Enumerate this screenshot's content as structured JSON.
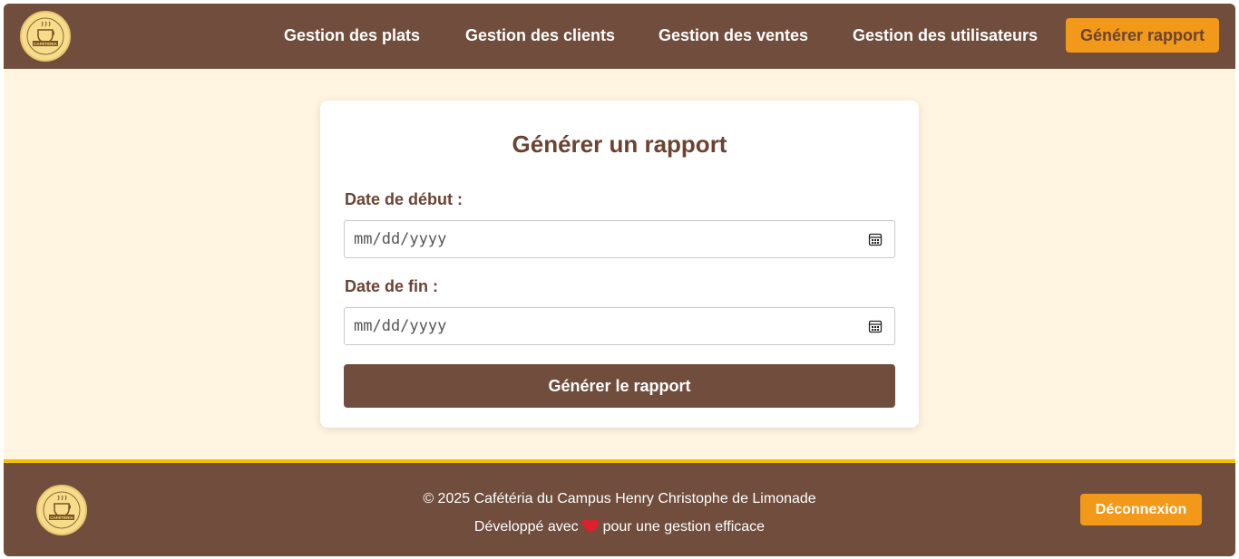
{
  "header": {
    "logo_text": "CAFÉTÉRIA",
    "nav": [
      {
        "label": "Gestion des plats"
      },
      {
        "label": "Gestion des clients"
      },
      {
        "label": "Gestion des ventes"
      },
      {
        "label": "Gestion des utilisateurs"
      }
    ],
    "cta_label": "Générer rapport"
  },
  "form": {
    "title": "Générer un rapport",
    "start_label": "Date de début :",
    "start_placeholder": "mm/dd/yyyy",
    "end_label": "Date de fin :",
    "end_placeholder": "mm/dd/yyyy",
    "submit_label": "Générer le rapport"
  },
  "footer": {
    "copyright": "© 2025 Cafétéria du Campus Henry Christophe de Limonade",
    "dev_prefix": "Développé avec",
    "dev_suffix": "pour une gestion efficace",
    "logout_label": "Déconnexion"
  },
  "colors": {
    "brown": "#704d3c",
    "cream": "#fff5e0",
    "orange": "#f2991a",
    "yellow_border": "#f5c000"
  }
}
